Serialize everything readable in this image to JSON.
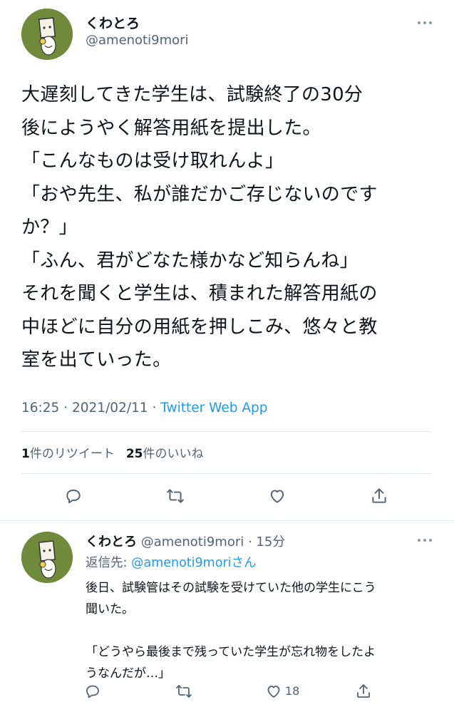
{
  "main_tweet": {
    "display_name": "くわとろ",
    "handle": "@amenoti9mori",
    "body": "大遅刻してきた学生は、試験終了の30分\n後にようやく解答用紙を提出した。\n「こんなものは受け取れんよ」\n「おや先生、私が誰だかご存じないのです\nか？」\n「ふん、君がどなた様かなど知らんね」\nそれを聞くと学生は、積まれた解答用紙の\n中ほどに自分の用紙を押しこみ、悠々と教\n室を出ていった。",
    "time": "16:25",
    "dot": " · ",
    "date": "2021/02/11",
    "dot2": " · ",
    "source": "Twitter Web App",
    "retweet_count": "1",
    "retweet_label": "件のリツイート",
    "like_count": "25",
    "like_label": "件のいいね"
  },
  "reply_tweet": {
    "display_name": "くわとろ",
    "handle_time": " @amenoti9mori · 15分",
    "reply_prefix": "返信先: ",
    "reply_mention": "@amenoti9moriさん",
    "body": "後日、試験管はその試験を受けていた他の学生にこう\n聞いた。\n\n「どうやら最後まで残っていた学生が忘れ物をしたよ\nうなんだが…」",
    "like_count": "18"
  },
  "icons": [
    "more-icon",
    "reply-icon",
    "retweet-icon",
    "like-icon",
    "share-icon"
  ],
  "colors": {
    "accent": "#1d9bf0",
    "secondary_text": "#536471",
    "avatar_bg": "#6f8a3a"
  }
}
